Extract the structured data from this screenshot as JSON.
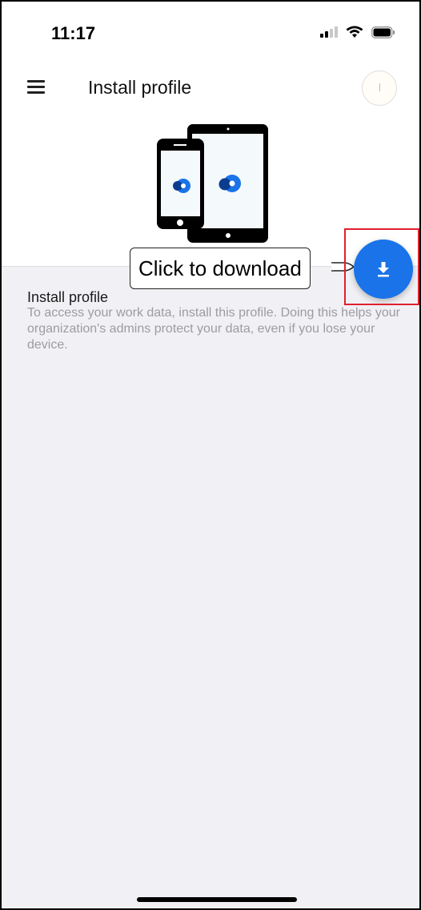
{
  "status_bar": {
    "time": "11:17",
    "icons": [
      "signal-icon",
      "wifi-icon",
      "battery-icon"
    ]
  },
  "app_bar": {
    "title": "Install profile",
    "menu_icon": "menu-icon",
    "avatar_icon": "avatar-icon"
  },
  "hero": {
    "illustration": "devices-illustration",
    "accent_color": "#1a73e8"
  },
  "content": {
    "section_title": "Install profile",
    "description": "To access your work data, install this profile. Doing this helps your organization's admins protect your data, even if you lose your device."
  },
  "download": {
    "icon": "download-icon",
    "tooltip": "Click to download",
    "button_color": "#1a73e8",
    "highlight_color": "#e0202f"
  }
}
